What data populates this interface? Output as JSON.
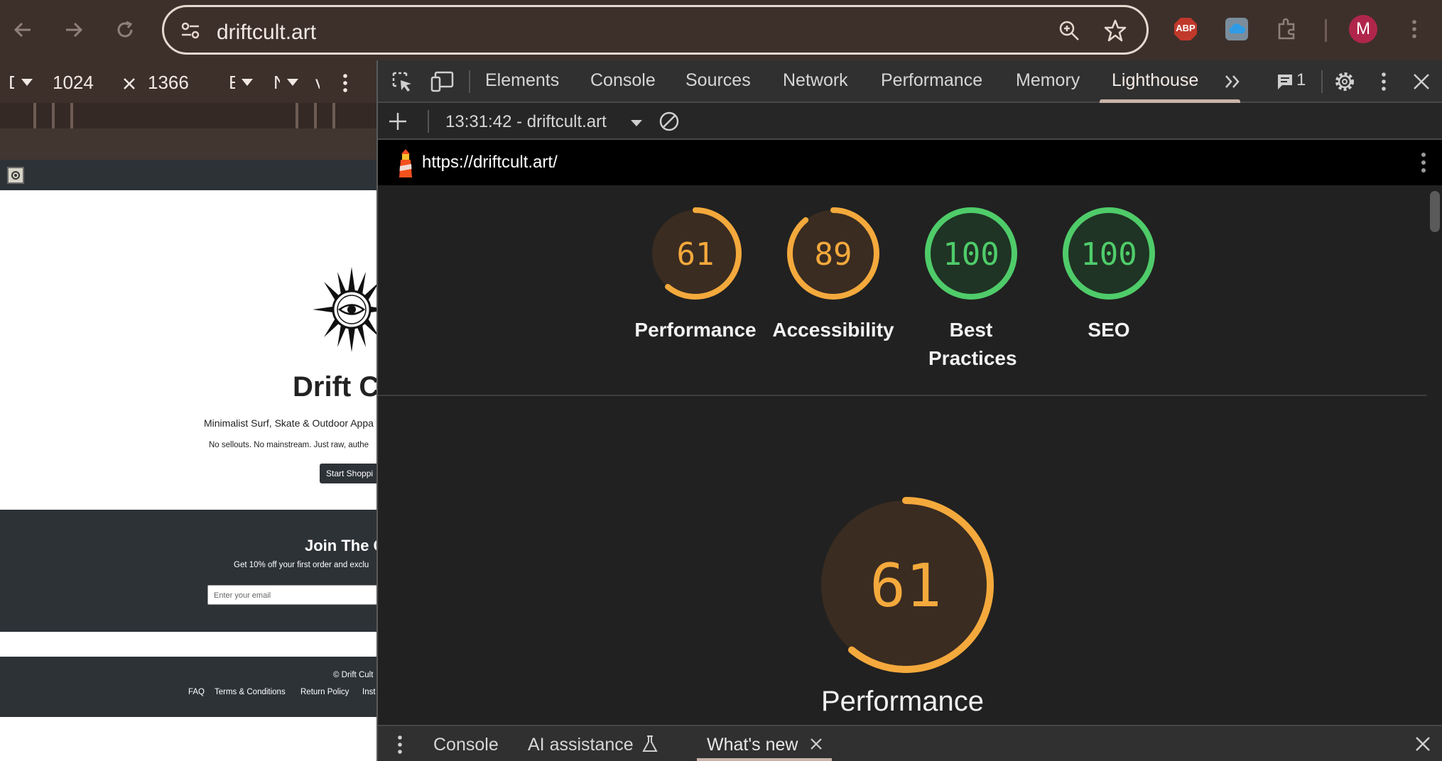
{
  "browser": {
    "url": "driftcult.art",
    "profile_initial": "M",
    "abp_label": "ABP"
  },
  "device_toolbar": {
    "dim_label": "Dimensions",
    "width": "1024",
    "height": "1366",
    "zoom_short": "E",
    "throttle_short": "N",
    "extra_short": "v"
  },
  "page_preview": {
    "brand": "Drift C",
    "tagline": "Minimalist Surf, Skate & Outdoor Appa",
    "subline": "No sellouts. No mainstream. Just raw, authe",
    "cta": "Start Shoppi",
    "join_title": "Join The C",
    "join_sub": "Get 10% off your first order and exclu",
    "email_placeholder": "Enter your email",
    "copyright": "© Drift Cult",
    "footer_links": [
      "FAQ",
      "Terms & Conditions",
      "Return Policy",
      "Inst"
    ]
  },
  "devtools": {
    "tabs": [
      "Elements",
      "Console",
      "Sources",
      "Network",
      "Performance",
      "Memory",
      "Lighthouse"
    ],
    "active_tab": "Lighthouse",
    "issues_count": "1",
    "report_select": "13:31:42 - driftcult.art",
    "report_url": "https://driftcult.art/",
    "drawer_tabs": [
      "Console",
      "AI assistance",
      "What's new"
    ]
  },
  "lighthouse": {
    "scores": [
      {
        "label": "Performance",
        "value": 61,
        "status": "average"
      },
      {
        "label": "Accessibility",
        "value": 89,
        "status": "average"
      },
      {
        "label": "Best Practices",
        "value": 100,
        "status": "pass"
      },
      {
        "label": "SEO",
        "value": 100,
        "status": "pass"
      }
    ],
    "big_score": {
      "label": "Performance",
      "value": 61
    },
    "colors": {
      "average": "#f4a93c",
      "pass": "#4fcc6a",
      "avg_bg": "#3a2c21",
      "pass_bg": "#1f3424"
    }
  }
}
